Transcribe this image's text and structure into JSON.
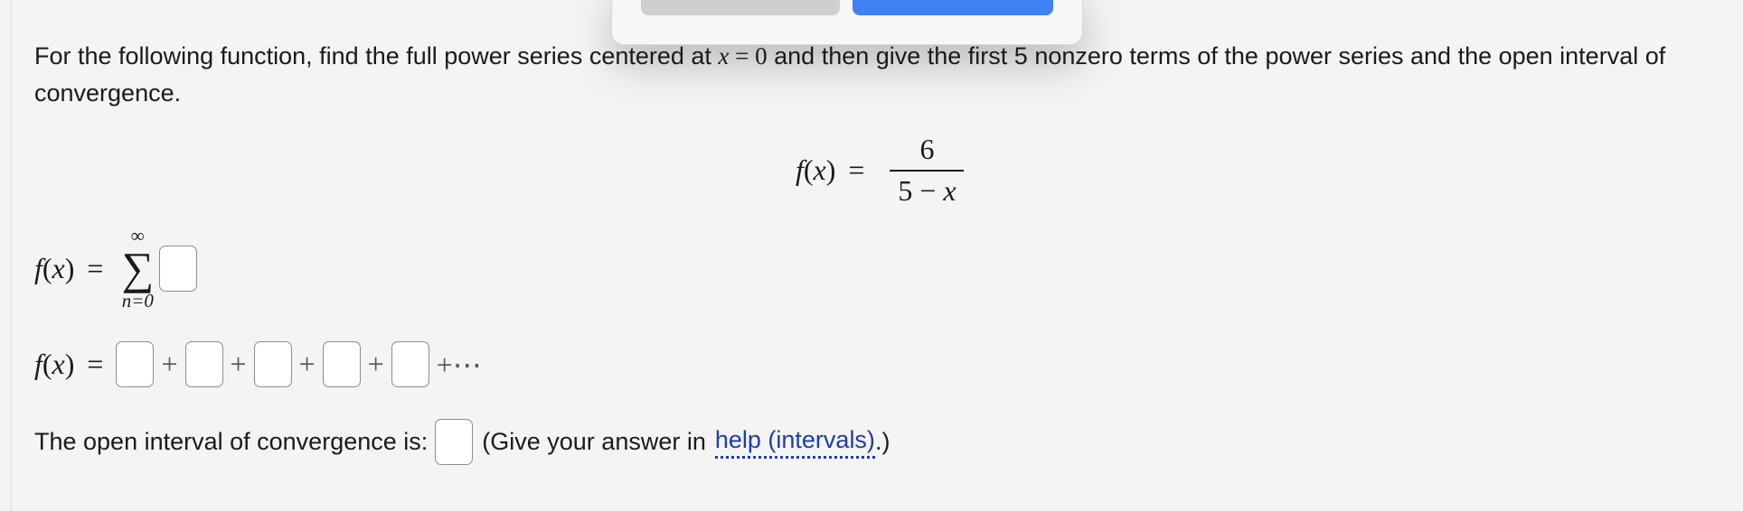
{
  "problem": {
    "text_before": "For the following function, find the full power series centered at ",
    "var": "x",
    "equals": "=",
    "zero": "0",
    "text_after": " and then give the first 5 nonzero terms of the power series and the open interval of convergence."
  },
  "function_display": {
    "lhs_f": "f",
    "lhs_open": "(",
    "lhs_var": "x",
    "lhs_close": ")",
    "equals": "=",
    "numerator": "6",
    "den_a": "5",
    "den_minus": "−",
    "den_var": "x"
  },
  "sum_row": {
    "f": "f",
    "open": "(",
    "var": "x",
    "close": ")",
    "equals": "=",
    "upper_limit": "∞",
    "sigma": "∑",
    "lower_limit": "n=0"
  },
  "series_row": {
    "f": "f",
    "open": "(",
    "var": "x",
    "close": ")",
    "equals": "=",
    "plus": "+",
    "ellipsis": "+⋯"
  },
  "interval": {
    "label": "The open interval of convergence is:",
    "hint_before": "(Give your answer in",
    "help_link": "help (intervals)",
    "hint_after": ".)"
  },
  "colors": {
    "link": "#1b3ea7",
    "ok_button": "#3f82f6",
    "cancel_button": "#cfcfcf",
    "background": "#f4f4f4"
  }
}
